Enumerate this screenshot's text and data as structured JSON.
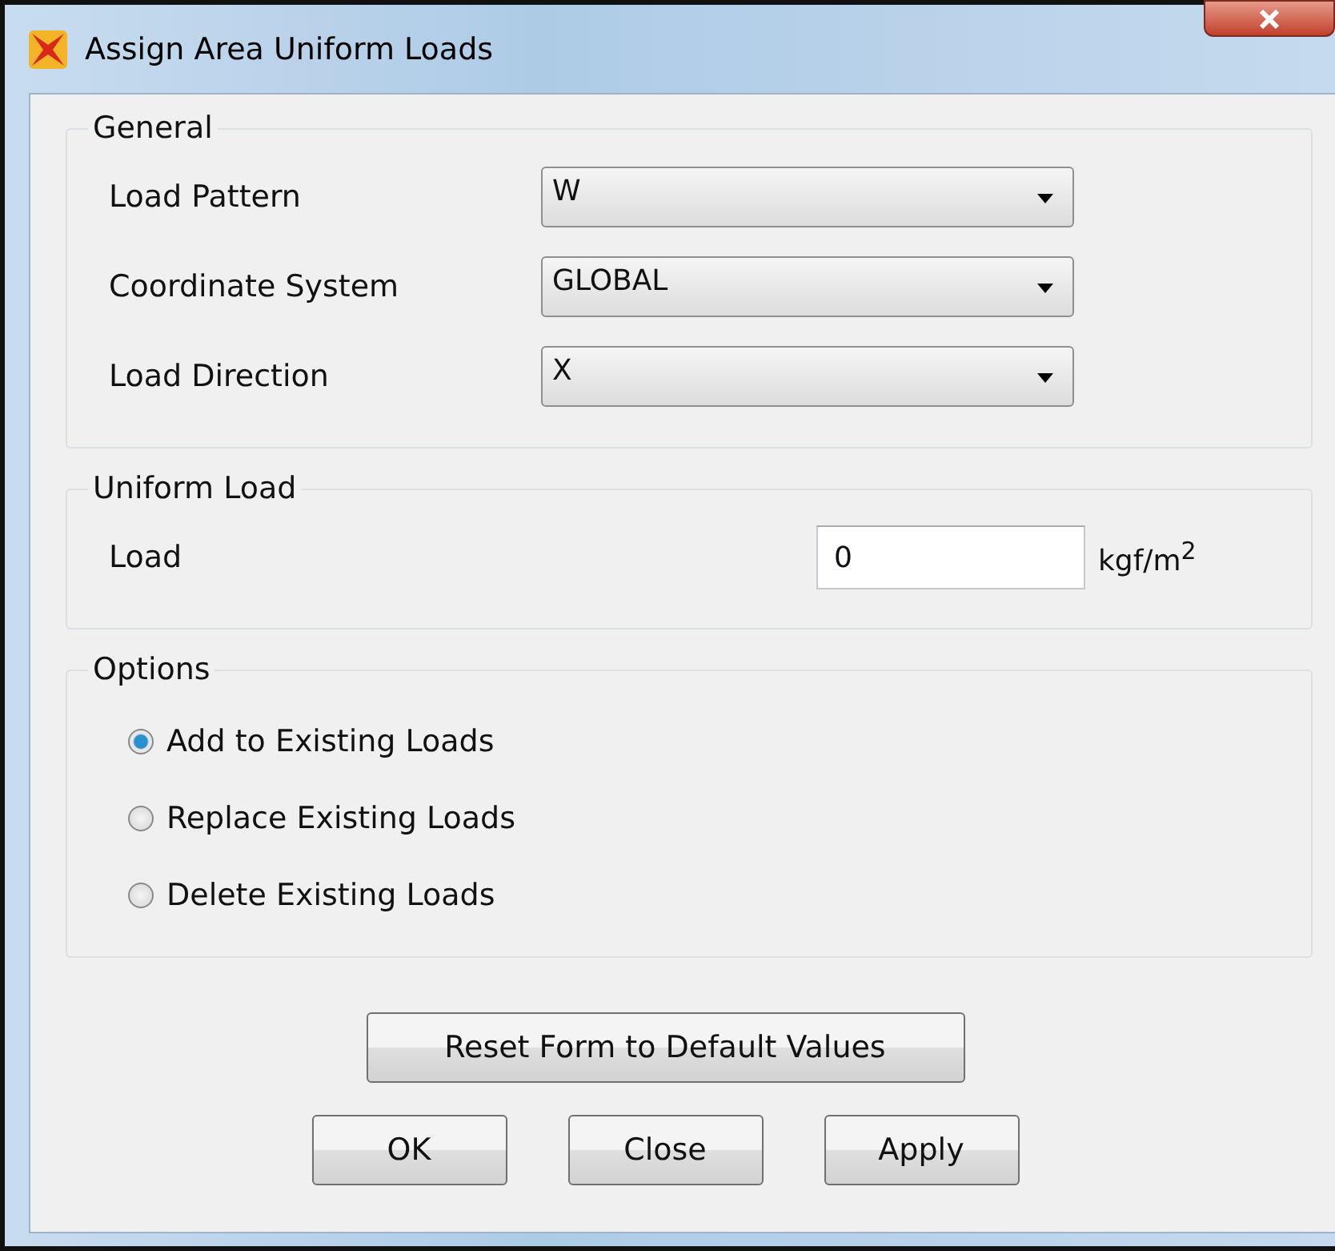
{
  "window": {
    "title": "Assign Area Uniform Loads"
  },
  "general": {
    "title": "General",
    "fields": [
      {
        "label": "Load Pattern",
        "value": "W"
      },
      {
        "label": "Coordinate System",
        "value": "GLOBAL"
      },
      {
        "label": "Load Direction",
        "value": "X"
      }
    ]
  },
  "uniform_load": {
    "title": "Uniform Load",
    "label": "Load",
    "value": "0",
    "unit": "kgf/m$^{2}$"
  },
  "options": {
    "title": "Options",
    "items": [
      {
        "label": "Add to Existing Loads",
        "selected": true
      },
      {
        "label": "Replace Existing Loads",
        "selected": false
      },
      {
        "label": "Delete Existing Loads",
        "selected": false
      }
    ]
  },
  "reset_button": "Reset Form to Default Values",
  "buttons": [
    "OK",
    "Close",
    "Apply"
  ]
}
